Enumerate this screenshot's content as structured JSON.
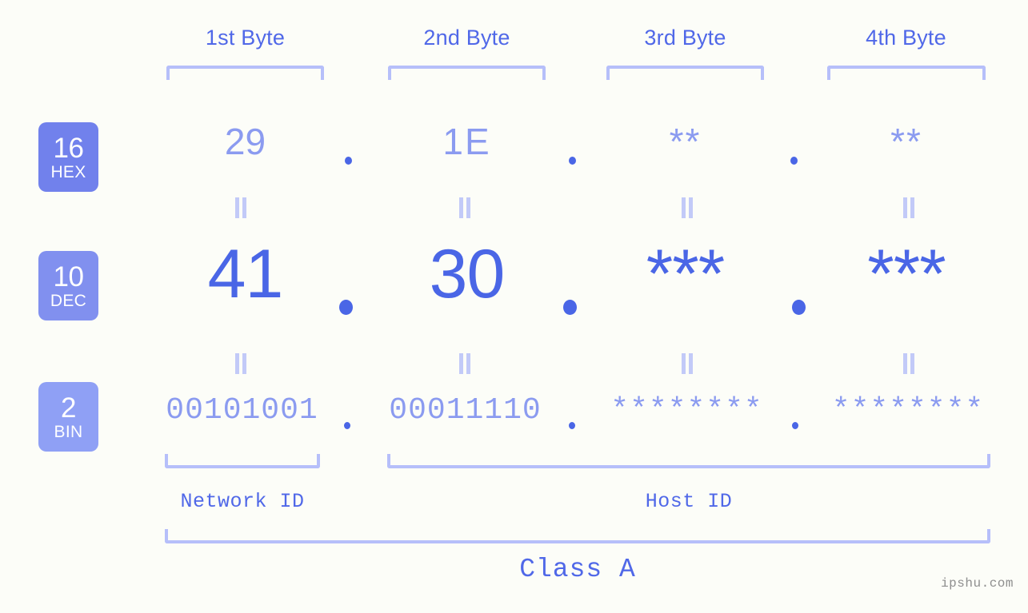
{
  "background_color": "#fcfdf8",
  "accent_strong": "#4a66e6",
  "accent_mid": "#5068e8",
  "accent_light": "#8b9bf0",
  "bracket_color": "#b6bffa",
  "headers": {
    "byte1": "1st Byte",
    "byte2": "2nd Byte",
    "byte3": "3rd Byte",
    "byte4": "4th Byte"
  },
  "rows": [
    {
      "key": "hex",
      "base_number": "16",
      "base_name": "HEX",
      "badge_color": "#7181ec",
      "values": [
        "29",
        "1E",
        "**",
        "**"
      ],
      "separator": "."
    },
    {
      "key": "dec",
      "base_number": "10",
      "base_name": "DEC",
      "badge_color": "#8190ef",
      "values": [
        "41",
        "30",
        "***",
        "***"
      ],
      "separator": "."
    },
    {
      "key": "bin",
      "base_number": "2",
      "base_name": "BIN",
      "badge_color": "#8fa0f5",
      "values": [
        "00101001",
        "00011110",
        "********",
        "********"
      ],
      "separator": "."
    }
  ],
  "equals_symbol": "||",
  "segments": {
    "network_id": "Network ID",
    "host_id": "Host ID"
  },
  "class_label": "Class A",
  "watermark": "ipshu.com"
}
